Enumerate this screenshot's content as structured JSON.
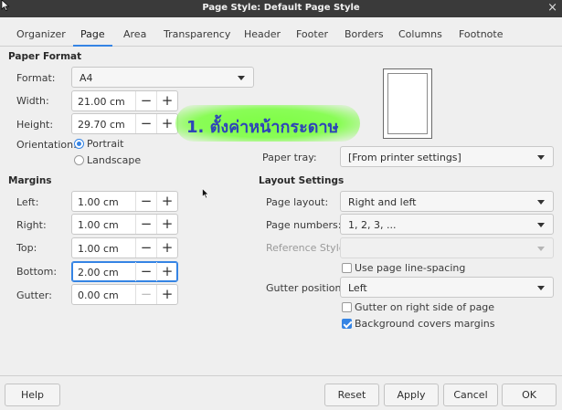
{
  "window": {
    "title": "Page Style: Default Page Style",
    "close_glyph": "×"
  },
  "tabs": [
    {
      "label": "Organizer"
    },
    {
      "label": "Page",
      "active": true
    },
    {
      "label": "Area"
    },
    {
      "label": "Transparency"
    },
    {
      "label": "Header"
    },
    {
      "label": "Footer"
    },
    {
      "label": "Borders"
    },
    {
      "label": "Columns"
    },
    {
      "label": "Footnote"
    }
  ],
  "paper_format": {
    "title": "Paper Format",
    "format_label": "Format:",
    "format_value": "A4",
    "width_label": "Width:",
    "width_value": "21.00 cm",
    "height_label": "Height:",
    "height_value": "29.70 cm",
    "orientation_label": "Orientation:",
    "portrait_label": "Portrait",
    "landscape_label": "Landscape",
    "orientation_selected": "Portrait"
  },
  "paper_tray": {
    "label": "Paper tray:",
    "value": "[From printer settings]"
  },
  "margins": {
    "title": "Margins",
    "left_label": "Left:",
    "left_value": "1.00 cm",
    "right_label": "Right:",
    "right_value": "1.00 cm",
    "top_label": "Top:",
    "top_value": "1.00 cm",
    "bottom_label": "Bottom:",
    "bottom_value": "2.00 cm",
    "gutter_label": "Gutter:",
    "gutter_value": "0.00 cm"
  },
  "layout_settings": {
    "title": "Layout Settings",
    "page_layout_label": "Page layout:",
    "page_layout_value": "Right and left",
    "page_numbers_label": "Page numbers:",
    "page_numbers_value": "1, 2, 3, ...",
    "reference_style_label": "Reference Style:",
    "reference_style_value": "",
    "use_line_spacing_label": "Use page line-spacing",
    "use_line_spacing_checked": false,
    "gutter_position_label": "Gutter position:",
    "gutter_position_value": "Left",
    "gutter_right_label": "Gutter on right side of page",
    "gutter_right_checked": false,
    "bg_covers_label": "Background covers margins",
    "bg_covers_checked": true
  },
  "spin_glyphs": {
    "minus": "−",
    "plus": "+"
  },
  "annotation": {
    "text": "1. ตั้งค่าหน้ากระดาษ",
    "color": "#78ff3c"
  },
  "buttons": {
    "help": "Help",
    "reset": "Reset",
    "apply": "Apply",
    "cancel": "Cancel",
    "ok": "OK"
  },
  "colors": {
    "accent": "#3584e4",
    "titlebar": "#3a3a3a"
  }
}
